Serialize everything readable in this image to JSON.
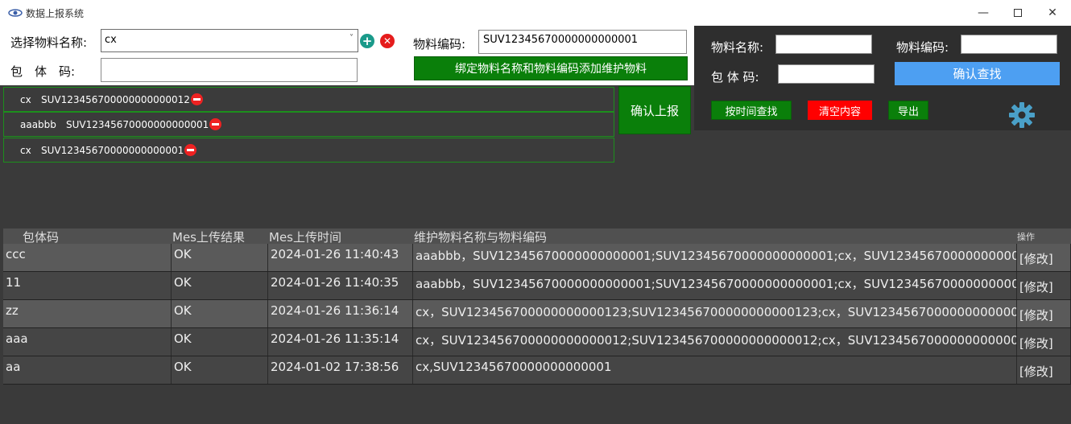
{
  "window": {
    "title": "数据上报系统"
  },
  "form": {
    "material_name_label": "选择物料名称:",
    "material_name_value": "cx",
    "package_code_label": "包　体　码:",
    "package_code_value": "",
    "material_code_label": "物料编码:",
    "material_code_value": "SUV12345670000000000001",
    "bind_button": "绑定物料名称和物料编码添加维护物料"
  },
  "list": [
    {
      "name": "cx",
      "code": "SUV123456700000000000012"
    },
    {
      "name": "aaabbb",
      "code": "SUV12345670000000000001"
    },
    {
      "name": "cx",
      "code": "SUV12345670000000000001"
    }
  ],
  "submit_button": "确认上报",
  "search": {
    "name_label": "物料名称:",
    "name_value": "",
    "code_label": "物料编码:",
    "code_value": "",
    "pkg_label": "包 体 码:",
    "pkg_value": "",
    "confirm_button": "确认查找",
    "by_time_button": "按时间查找",
    "clear_button": "清空内容",
    "export_button": "导出"
  },
  "table": {
    "headers": [
      "包体码",
      "Mes上传结果",
      "Mes上传时间",
      "维护物料名称与物料编码",
      "操作"
    ],
    "edit_label": "[修改]",
    "rows": [
      {
        "pkg": "ccc",
        "result": "OK",
        "time": "2024-01-26 11:40:43",
        "materials": "aaabbb，SUV12345670000000000001;SUV12345670000000000001;cx，SUV12345670000000000"
      },
      {
        "pkg": "11",
        "result": "OK",
        "time": "2024-01-26 11:40:35",
        "materials": "aaabbb，SUV12345670000000000001;SUV12345670000000000001;cx，SUV12345670000000000"
      },
      {
        "pkg": "zz",
        "result": "OK",
        "time": "2024-01-26 11:36:14",
        "materials": "cx，SUV123456700000000000123;SUV123456700000000000123;cx，SUV1234567000000000000"
      },
      {
        "pkg": "aaa",
        "result": "OK",
        "time": "2024-01-26 11:35:14",
        "materials": "cx，SUV123456700000000000012;SUV123456700000000000012;cx，SUV1234567000000000000"
      },
      {
        "pkg": "aa",
        "result": "OK",
        "time": "2024-01-02 17:38:56",
        "materials": "cx,SUV12345670000000000001"
      }
    ]
  },
  "colors": {
    "row_alt": "#5a5a5a",
    "row": "#454545",
    "accent_blue": "#4d9ff2",
    "green": "#0a7f0a",
    "red": "#ff0000"
  }
}
